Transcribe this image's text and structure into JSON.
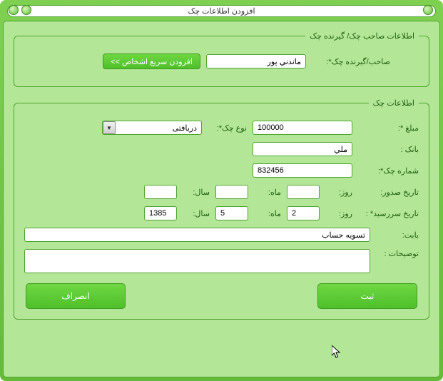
{
  "window": {
    "title": "افزودن اطلاعات چک"
  },
  "group1": {
    "legend": "اطلاعات صاحب چک/ گیرنده چک",
    "owner_label": "صاحب/گیرنده چک*:",
    "owner_value": "ماندني پور",
    "quick_add_label": "افزودن سریع اشخاص >>"
  },
  "group2": {
    "legend": "اطلاعات چک",
    "amount_label": "مبلغ *:",
    "amount_value": "100000",
    "type_label": "نوع چک*:",
    "type_value": "دریافتی",
    "bank_label": "بانک :",
    "bank_value": "ملي",
    "cheque_no_label": "شماره چک*:",
    "cheque_no_value": "832456",
    "issue_date_label": "تاریخ صدور:",
    "due_date_label": "تاریخ سررسید* :",
    "day_label": "روز:",
    "month_label": "ماه:",
    "year_label": "سال:",
    "issue_day": "",
    "issue_month": "",
    "issue_year": "",
    "due_day": "2",
    "due_month": "5",
    "due_year": "1385",
    "for_label": "بابت:",
    "for_value": "تسویه حساب",
    "notes_label": "توضیحات :",
    "notes_value": "",
    "submit_label": "ثبت",
    "cancel_label": "انصراف"
  }
}
